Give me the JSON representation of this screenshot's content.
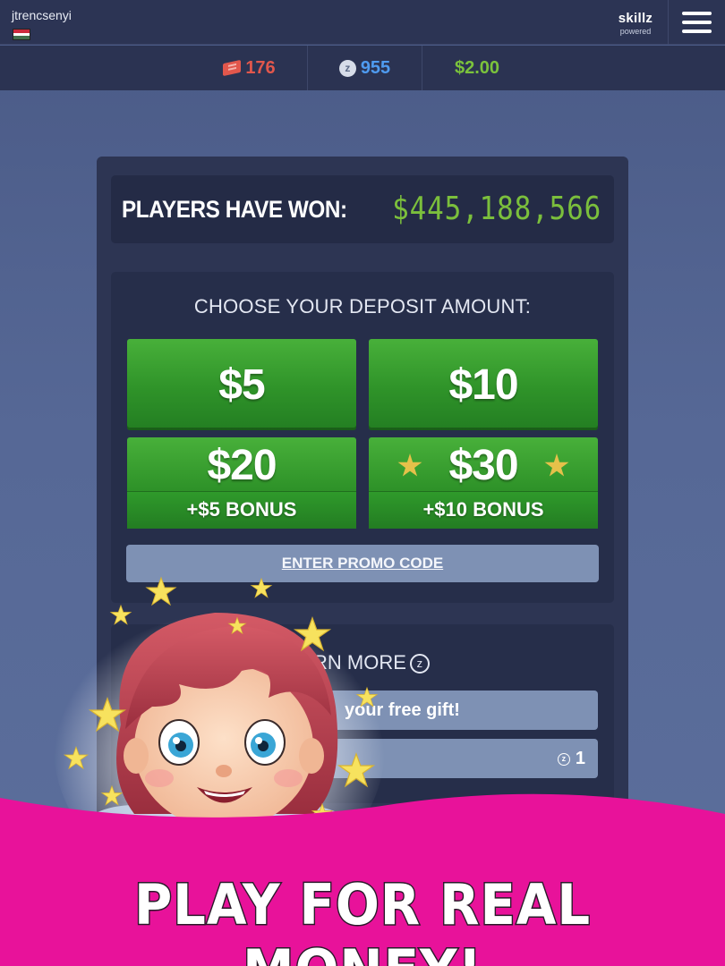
{
  "topbar": {
    "username": "jtrencsenyi",
    "flag": [
      "#cd2a3e",
      "#ffffff",
      "#436f4d"
    ],
    "brand_name": "skillz",
    "brand_sub": "powered",
    "menu_icon": "hamburger-icon"
  },
  "currency": {
    "tickets": "176",
    "z_coins": "955",
    "cash": "$2.00",
    "tickets_icon": "ticket-icon",
    "z_icon": "z-coin-icon"
  },
  "winnings": {
    "label": "PLAYERS HAVE WON:",
    "amount": "$445,188,566"
  },
  "deposit": {
    "title": "CHOOSE YOUR DEPOSIT AMOUNT:",
    "options": [
      {
        "amount": "$5"
      },
      {
        "amount": "$10"
      },
      {
        "amount": "$20",
        "bonus": "+$5 BONUS"
      },
      {
        "amount": "$30",
        "bonus": "+$10 BONUS"
      }
    ],
    "promo_label": "ENTER PROMO CODE"
  },
  "earn": {
    "title": "RN MORE",
    "title_icon": "z",
    "gift_label": "your free gift!",
    "z_value": "1",
    "z_symbol": "z"
  },
  "banner": {
    "text": "PLAY FOR REAL MONEY!",
    "color": "#e8129a"
  },
  "colors": {
    "accent_green": "#3aa132",
    "tickets_red": "#e2574c",
    "z_blue": "#4f9bf0",
    "cash_green": "#7bc33c"
  }
}
